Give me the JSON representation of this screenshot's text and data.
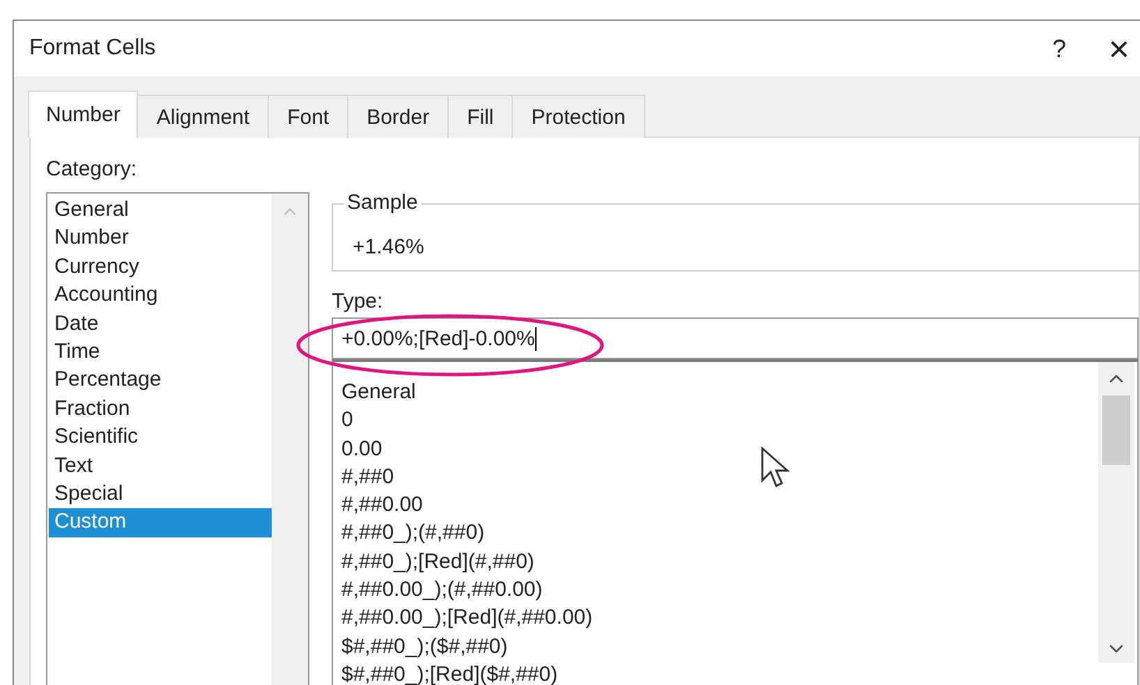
{
  "window": {
    "title": "Format Cells",
    "help_button": "?",
    "close_button": "×"
  },
  "tabs": [
    {
      "label": "Number",
      "selected": true
    },
    {
      "label": "Alignment",
      "selected": false
    },
    {
      "label": "Font",
      "selected": false
    },
    {
      "label": "Border",
      "selected": false
    },
    {
      "label": "Fill",
      "selected": false
    },
    {
      "label": "Protection",
      "selected": false
    }
  ],
  "category": {
    "label": "Category:",
    "items": [
      {
        "label": "General",
        "selected": false
      },
      {
        "label": "Number",
        "selected": false
      },
      {
        "label": "Currency",
        "selected": false
      },
      {
        "label": "Accounting",
        "selected": false
      },
      {
        "label": "Date",
        "selected": false
      },
      {
        "label": "Time",
        "selected": false
      },
      {
        "label": "Percentage",
        "selected": false
      },
      {
        "label": "Fraction",
        "selected": false
      },
      {
        "label": "Scientific",
        "selected": false
      },
      {
        "label": "Text",
        "selected": false
      },
      {
        "label": "Special",
        "selected": false
      },
      {
        "label": "Custom",
        "selected": true
      }
    ]
  },
  "sample": {
    "label": "Sample",
    "value": "+1.46%"
  },
  "type": {
    "label": "Type:",
    "value": "+0.00%;[Red]-0.00%",
    "formats": [
      "General",
      "0",
      "0.00",
      "#,##0",
      "#,##0.00",
      "#,##0_);(#,##0)",
      "#,##0_);[Red](#,##0)",
      "#,##0.00_);(#,##0.00)",
      "#,##0.00_);[Red](#,##0.00)",
      "$#,##0_);($#,##0)",
      "$#,##0_);[Red]($#,##0)"
    ]
  },
  "highlight": {
    "kind": "ellipse"
  }
}
